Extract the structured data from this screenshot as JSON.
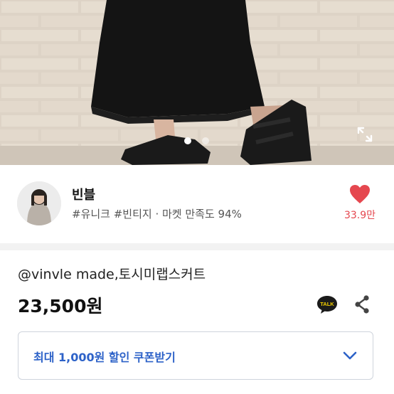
{
  "gallery": {
    "slide_indicator": {
      "total": 2,
      "active": 1
    },
    "expand_icon": "expand-icon"
  },
  "seller": {
    "name": "빈블",
    "tags": "#유니크 #빈티지 · 마켓 만족도 94%",
    "likes": "33.9만",
    "heart_color": "#e5474f"
  },
  "product": {
    "title": "@vinvle made,토시미랩스커트",
    "price": "23,500원"
  },
  "actions": {
    "talk_label": "TALK",
    "talk_icon": "kakaotalk-icon",
    "share_icon": "share-icon"
  },
  "coupon": {
    "label": "최대 1,000원 할인 쿠폰받기",
    "accent": "#2d62c8"
  }
}
